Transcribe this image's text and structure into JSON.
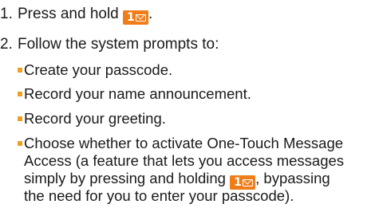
{
  "steps": [
    {
      "number": "1.",
      "text_before_key": "Press and hold",
      "key": {
        "digit": "1",
        "icon": "envelope-icon",
        "color": "#f07d1a"
      },
      "text_after_key": "."
    },
    {
      "number": "2.",
      "text": "Follow the system prompts to:"
    }
  ],
  "bullets": [
    {
      "text": "Create your passcode."
    },
    {
      "text": "Record your name announcement."
    },
    {
      "text": "Record your greeting."
    },
    {
      "line1": "Choose whether to activate One-Touch Message",
      "line2": "Access (a feature that lets you access messages",
      "line3_before_key": "simply by pressing and holding",
      "line3_after_key": ", bypassing",
      "line4": "the need for you to enter your passcode)."
    }
  ],
  "colors": {
    "bullet": "#f0a020",
    "key_background": "#f07d1a",
    "text": "#1a1a1a"
  }
}
